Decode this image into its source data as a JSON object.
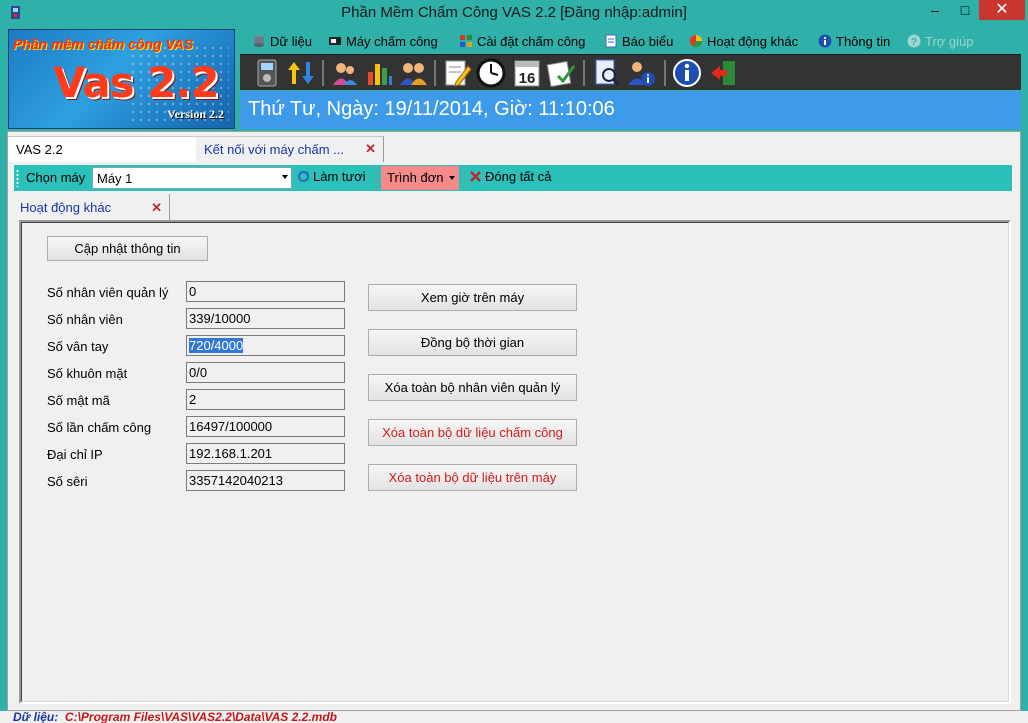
{
  "window": {
    "title": "Phần Mềm Chấm Công VAS 2.2 [Đăng nhập:admin]",
    "minimize": "–",
    "maximize": "□",
    "close": "✕"
  },
  "logo": {
    "brand": "Phần mềm chấm công VAS",
    "name": "Vas 2.2",
    "version": "Version 2.2"
  },
  "menu": [
    {
      "label": "Dữ liệu",
      "icon": "database-icon",
      "color": "#6a7a86"
    },
    {
      "label": "Máy chấm công",
      "icon": "device-icon",
      "color": "#222222"
    },
    {
      "label": "Cài đặt chấm công",
      "icon": "settings-grid-icon",
      "color": "#d23a2a"
    },
    {
      "label": "Báo biểu",
      "icon": "report-icon",
      "color": "#3b6fc0"
    },
    {
      "label": "Hoạt động khác",
      "icon": "pie-chart-icon",
      "color": "#e0381e"
    },
    {
      "label": "Thông tin",
      "icon": "info-icon",
      "color": "#1d4fb3"
    },
    {
      "label": "Trợ giúp",
      "icon": "help-icon",
      "color": "#9fd4d0"
    }
  ],
  "toolbar_icons": [
    "fingerprint-device-icon",
    "upload-download-arrows-icon",
    "users-group-icon",
    "bar-chart-icon",
    "employees-icon",
    "edit-document-icon",
    "clock-icon",
    "calendar-16-icon",
    "checklist-icon",
    "search-document-icon",
    "user-info-icon",
    "info-icon",
    "exit-icon"
  ],
  "date_text": "Thứ Tư, Ngày: 19/11/2014, Giờ: 11:10:06",
  "tabs": {
    "main_label": "VAS 2.2",
    "connect_label": "Kết nối với máy chấm ...",
    "close_symbol": "✕"
  },
  "command_bar": {
    "choose_machine_label": "Chọn máy",
    "machine_value": "Máy 1",
    "refresh_label": "Làm tươi",
    "menu_label": "Trình đơn",
    "close_all_label": "Đóng tất cả"
  },
  "subtab": {
    "label": "Hoạt động khác",
    "close_symbol": "✕"
  },
  "panel": {
    "update_button": "Cập nhật thông tin",
    "fields": [
      {
        "label": "Số nhân viên quản lý",
        "value": "0"
      },
      {
        "label": "Số nhân viên",
        "value": "339/10000"
      },
      {
        "label": "Số vân tay",
        "value": "720/4000"
      },
      {
        "label": "Số khuôn mặt",
        "value": "0/0"
      },
      {
        "label": "Số mật mã",
        "value": "2"
      },
      {
        "label": "Số lần chấm công",
        "value": "16497/100000"
      },
      {
        "label": "Đại chỉ IP",
        "value": "192.168.1.201"
      },
      {
        "label": "Số sêri",
        "value": "3357142040213"
      }
    ],
    "actions": [
      {
        "label": "Xem giờ trên máy",
        "danger": false
      },
      {
        "label": "Đồng bộ thời gian",
        "danger": false
      },
      {
        "label": "Xóa toàn bộ nhân viên quản lý",
        "danger": false
      },
      {
        "label": "Xóa toàn bộ dữ liệu chấm công",
        "danger": true
      },
      {
        "label": "Xóa toàn bộ dữ liệu trên máy",
        "danger": true
      }
    ]
  },
  "status": {
    "label": "Dữ liệu:",
    "path": "C:\\Program Files\\VAS\\VAS2.2\\Data\\VAS 2.2.mdb"
  },
  "colors": {
    "titlebar": "#2fb0a8",
    "datebar": "#3d9be9",
    "command_bar": "#2cc0ba",
    "menu_button": "#f58a8a",
    "danger_text": "#d01c1c"
  }
}
